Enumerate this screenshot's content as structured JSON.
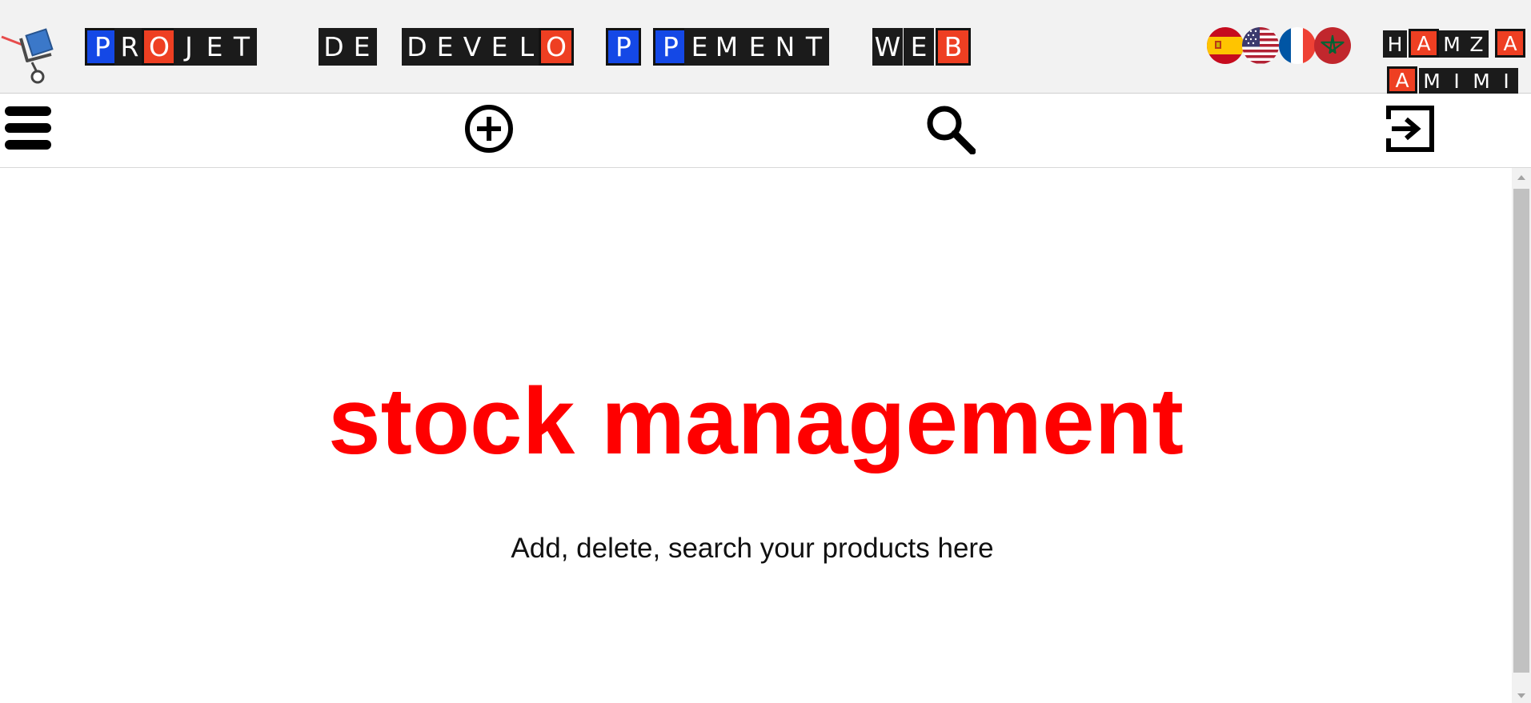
{
  "header": {
    "banner_letters": [
      "P",
      "R",
      "O",
      "J",
      "E",
      "T",
      "D",
      "E",
      "D",
      "E",
      "V",
      "E",
      "L",
      "O",
      "P",
      "P",
      "E",
      "M",
      "E",
      "N",
      "T",
      "W",
      "E",
      "B"
    ],
    "author_letters_line1": [
      "H",
      "A",
      "M",
      "Z",
      "A"
    ],
    "author_letters_line2": [
      "A",
      "M",
      "I",
      "M",
      "I"
    ],
    "logo_icon": "shopping-cart-icon",
    "languages": [
      {
        "icon": "flag-spain-icon"
      },
      {
        "icon": "flag-usa-icon"
      },
      {
        "icon": "flag-france-icon"
      },
      {
        "icon": "flag-morocco-icon"
      }
    ]
  },
  "toolbar": {
    "menu_icon": "hamburger-menu-icon",
    "add_icon": "add-circle-icon",
    "search_icon": "search-icon",
    "logout_icon": "logout-icon"
  },
  "main": {
    "title": "stock management",
    "subtitle": "Add, delete, search your products here"
  },
  "colors": {
    "title_red": "#ff0000",
    "tile_black": "#1b1b1b",
    "tile_blue": "#1448e6",
    "tile_orange": "#ee3f22",
    "header_bg": "#f2f2f2"
  }
}
